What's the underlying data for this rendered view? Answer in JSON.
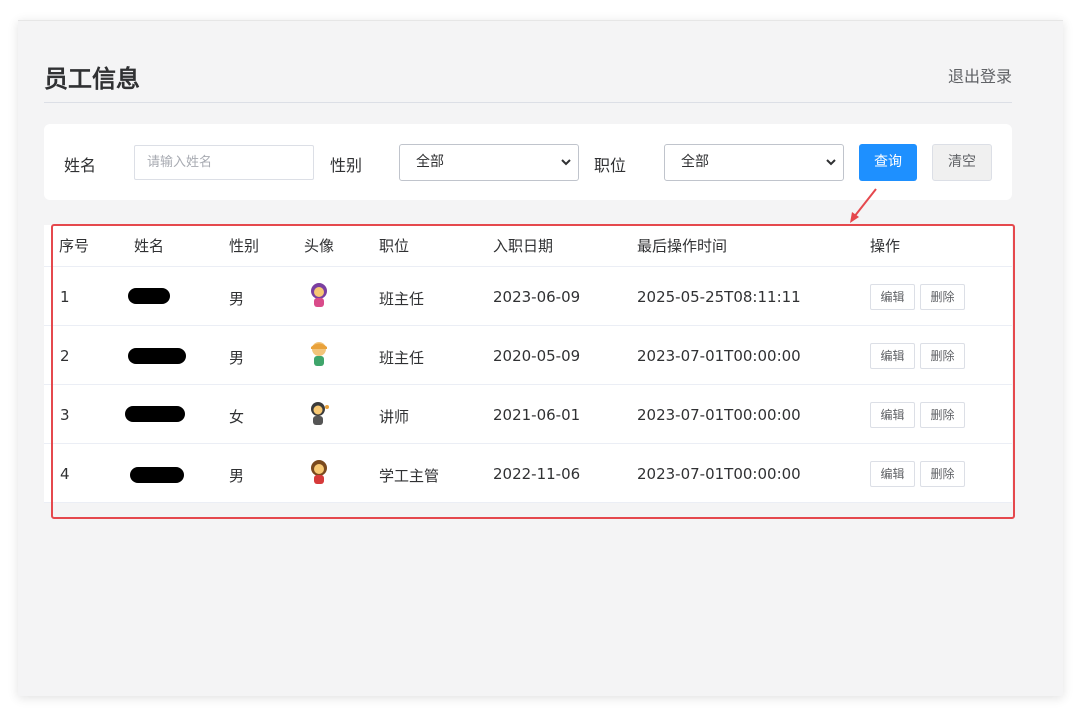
{
  "header": {
    "title": "员工信息",
    "logout": "退出登录"
  },
  "search": {
    "name_label": "姓名",
    "name_placeholder": "请输入姓名",
    "name_value": "",
    "gender_label": "性别",
    "gender_selected": "全部",
    "position_label": "职位",
    "position_selected": "全部",
    "query_button": "查询",
    "clear_button": "清空"
  },
  "table": {
    "columns": [
      "序号",
      "姓名",
      "性别",
      "头像",
      "职位",
      "入职日期",
      "最后操作时间",
      "操作"
    ],
    "rows": [
      {
        "index": "1",
        "gender": "男",
        "position": "班主任",
        "hire_date": "2023-06-09",
        "last_op": "2025-05-25T08:11:11"
      },
      {
        "index": "2",
        "gender": "男",
        "position": "班主任",
        "hire_date": "2020-05-09",
        "last_op": "2023-07-01T00:00:00"
      },
      {
        "index": "3",
        "gender": "女",
        "position": "讲师",
        "hire_date": "2021-06-01",
        "last_op": "2023-07-01T00:00:00"
      },
      {
        "index": "4",
        "gender": "男",
        "position": "学工主管",
        "hire_date": "2022-11-06",
        "last_op": "2023-07-01T00:00:00"
      }
    ],
    "edit_label": "编辑",
    "delete_label": "删除"
  },
  "colors": {
    "primary": "#1e90ff",
    "annotation": "#e5484d"
  }
}
